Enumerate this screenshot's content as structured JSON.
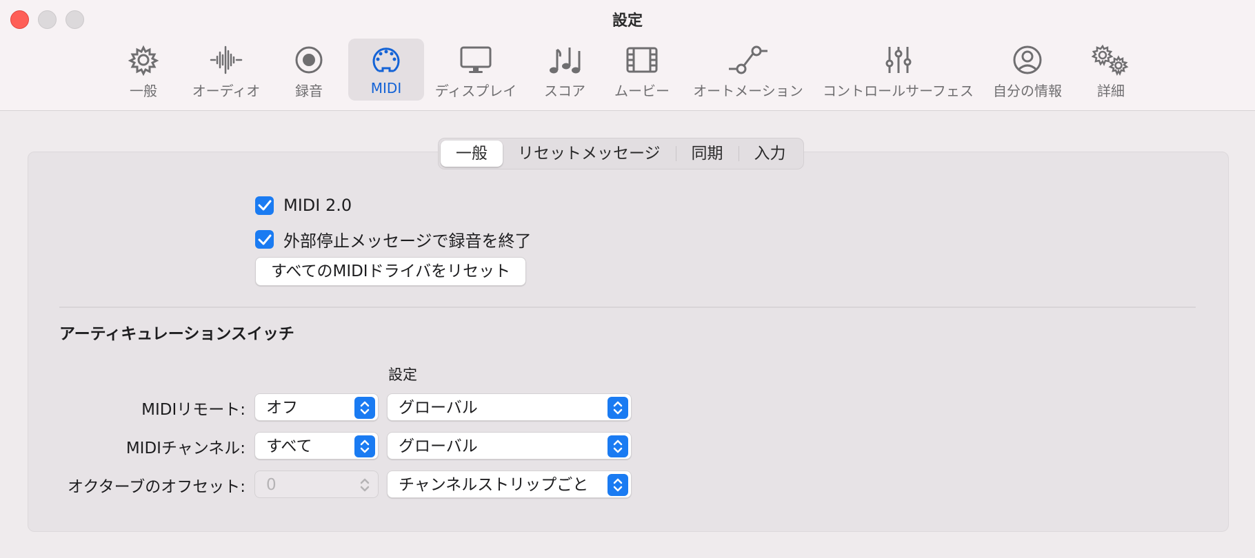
{
  "window": {
    "title": "設定",
    "traffic_lights": [
      "close",
      "minimize",
      "zoom"
    ]
  },
  "toolbar": {
    "items": [
      {
        "label": "一般",
        "icon": "gear-icon",
        "selected": false
      },
      {
        "label": "オーディオ",
        "icon": "waveform-icon",
        "selected": false
      },
      {
        "label": "録音",
        "icon": "record-icon",
        "selected": false
      },
      {
        "label": "MIDI",
        "icon": "midi-connector-icon",
        "selected": true
      },
      {
        "label": "ディスプレイ",
        "icon": "display-icon",
        "selected": false
      },
      {
        "label": "スコア",
        "icon": "music-notes-icon",
        "selected": false
      },
      {
        "label": "ムービー",
        "icon": "film-icon",
        "selected": false
      },
      {
        "label": "オートメーション",
        "icon": "automation-icon",
        "selected": false
      },
      {
        "label": "コントロールサーフェス",
        "icon": "sliders-icon",
        "selected": false
      },
      {
        "label": "自分の情報",
        "icon": "person-icon",
        "selected": false
      },
      {
        "label": "詳細",
        "icon": "gears-icon",
        "selected": false
      }
    ],
    "accent_color": "#1463d6"
  },
  "tabs": {
    "items": [
      "一般",
      "リセットメッセージ",
      "同期",
      "入力"
    ],
    "active": "一般"
  },
  "general": {
    "midi2": {
      "label": "MIDI 2.0",
      "checked": true
    },
    "external_stop": {
      "label": "外部停止メッセージで録音を終了",
      "checked": true
    },
    "reset_button": "すべてのMIDIドライバをリセット"
  },
  "articulation": {
    "title": "アーティキュレーションスイッチ",
    "column_header": "設定",
    "rows": [
      {
        "label": "MIDIリモート:",
        "value": "オフ",
        "setting": "グローバル",
        "disabled": false
      },
      {
        "label": "MIDIチャンネル:",
        "value": "すべて",
        "setting": "グローバル",
        "disabled": false
      },
      {
        "label": "オクターブのオフセット:",
        "value": "0",
        "setting": "チャンネルストリップごと",
        "disabled": true
      }
    ]
  },
  "colors": {
    "checkbox": "#1a7bf2",
    "close": "#fe5f57"
  }
}
